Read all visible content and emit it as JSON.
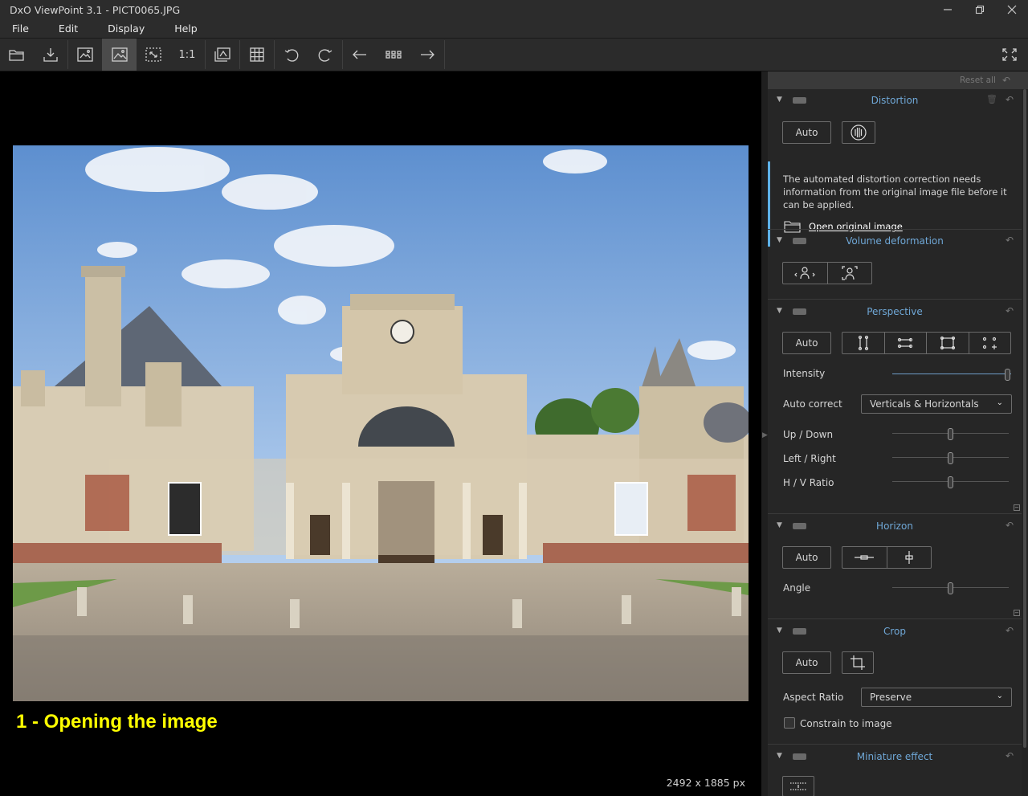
{
  "window": {
    "title": "DxO ViewPoint 3.1 - PICT0065.JPG",
    "minimize": "—",
    "restore": "❐",
    "close": "✕"
  },
  "menu": [
    "File",
    "Edit",
    "Display",
    "Help"
  ],
  "toolbar": {
    "one_to_one": "1:1",
    "buttons": [
      "open-folder",
      "export",
      "compare-split",
      "single-image",
      "fit-screen",
      "one-to-one",
      "before-after",
      "grid",
      "rotate-left",
      "rotate-right",
      "previous",
      "thumbnails",
      "next",
      "fullscreen"
    ]
  },
  "viewer": {
    "caption": "1 - Opening the image",
    "image_size": "2492 x 1885 px"
  },
  "panel": {
    "reset_all": "Reset all",
    "distortion": {
      "title": "Distortion",
      "auto": "Auto",
      "notice": "The automated distortion correction needs information from the original image file before it can be applied.",
      "link": "Open original image"
    },
    "volume": {
      "title": "Volume deformation"
    },
    "perspective": {
      "title": "Perspective",
      "auto": "Auto",
      "intensity_label": "Intensity",
      "intensity_value": 1.0,
      "auto_correct_label": "Auto correct",
      "auto_correct_value": "Verticals & Horizontals",
      "updown_label": "Up / Down",
      "leftright_label": "Left / Right",
      "hvratio_label": "H / V Ratio",
      "updown_value": 0.5,
      "leftright_value": 0.5,
      "hvratio_value": 0.5
    },
    "horizon": {
      "title": "Horizon",
      "auto": "Auto",
      "angle_label": "Angle",
      "angle_value": 0.5
    },
    "crop": {
      "title": "Crop",
      "auto": "Auto",
      "aspect_label": "Aspect Ratio",
      "aspect_value": "Preserve",
      "constrain_label": "Constrain to image",
      "constrain_checked": false
    },
    "miniature": {
      "title": "Miniature effect"
    }
  },
  "colors": {
    "accent": "#6fa7d6",
    "caption": "#ffff00",
    "notice_bar": "#5db1e8"
  }
}
